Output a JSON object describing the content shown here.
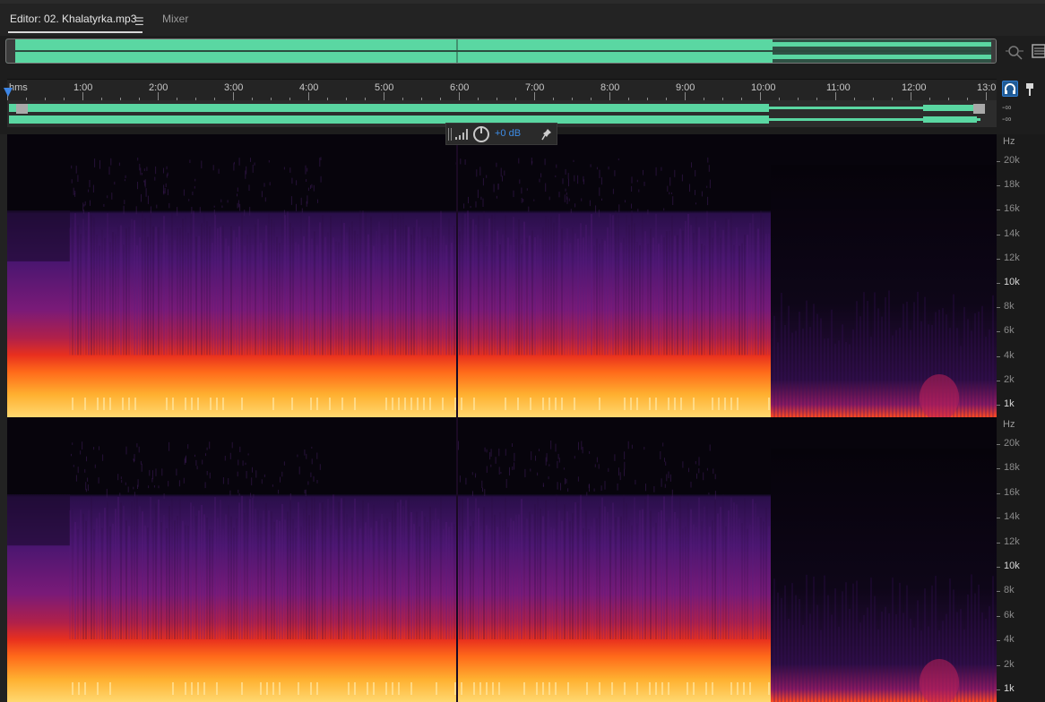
{
  "tabs": {
    "editor_label": "Editor: 02. Khalatyrka.mp3",
    "editor_menu_glyph": "☰",
    "mixer_label": "Mixer"
  },
  "colors": {
    "waveform": "#5ad7a2",
    "accent": "#3d8ce6",
    "background": "#1d1d1d"
  },
  "ruler": {
    "ticks": [
      "hms",
      "1:00",
      "2:00",
      "3:00",
      "4:00",
      "5:00",
      "6:00",
      "7:00",
      "8:00",
      "9:00",
      "10:00",
      "11:00",
      "12:00",
      "13:0"
    ]
  },
  "levels": {
    "ch1": "-∞",
    "ch2": "-∞"
  },
  "hud": {
    "gain": "+0 dB"
  },
  "frequency_axis": {
    "unit": "Hz",
    "labels": [
      "20k",
      "18k",
      "16k",
      "14k",
      "12k",
      "10k",
      "8k",
      "6k",
      "4k",
      "2k",
      "1k"
    ]
  },
  "icons": [
    "zoom-icon",
    "panel-menu-icon",
    "headphones-icon",
    "marker-pin-icon",
    "volume-knob-icon",
    "pin-icon"
  ]
}
